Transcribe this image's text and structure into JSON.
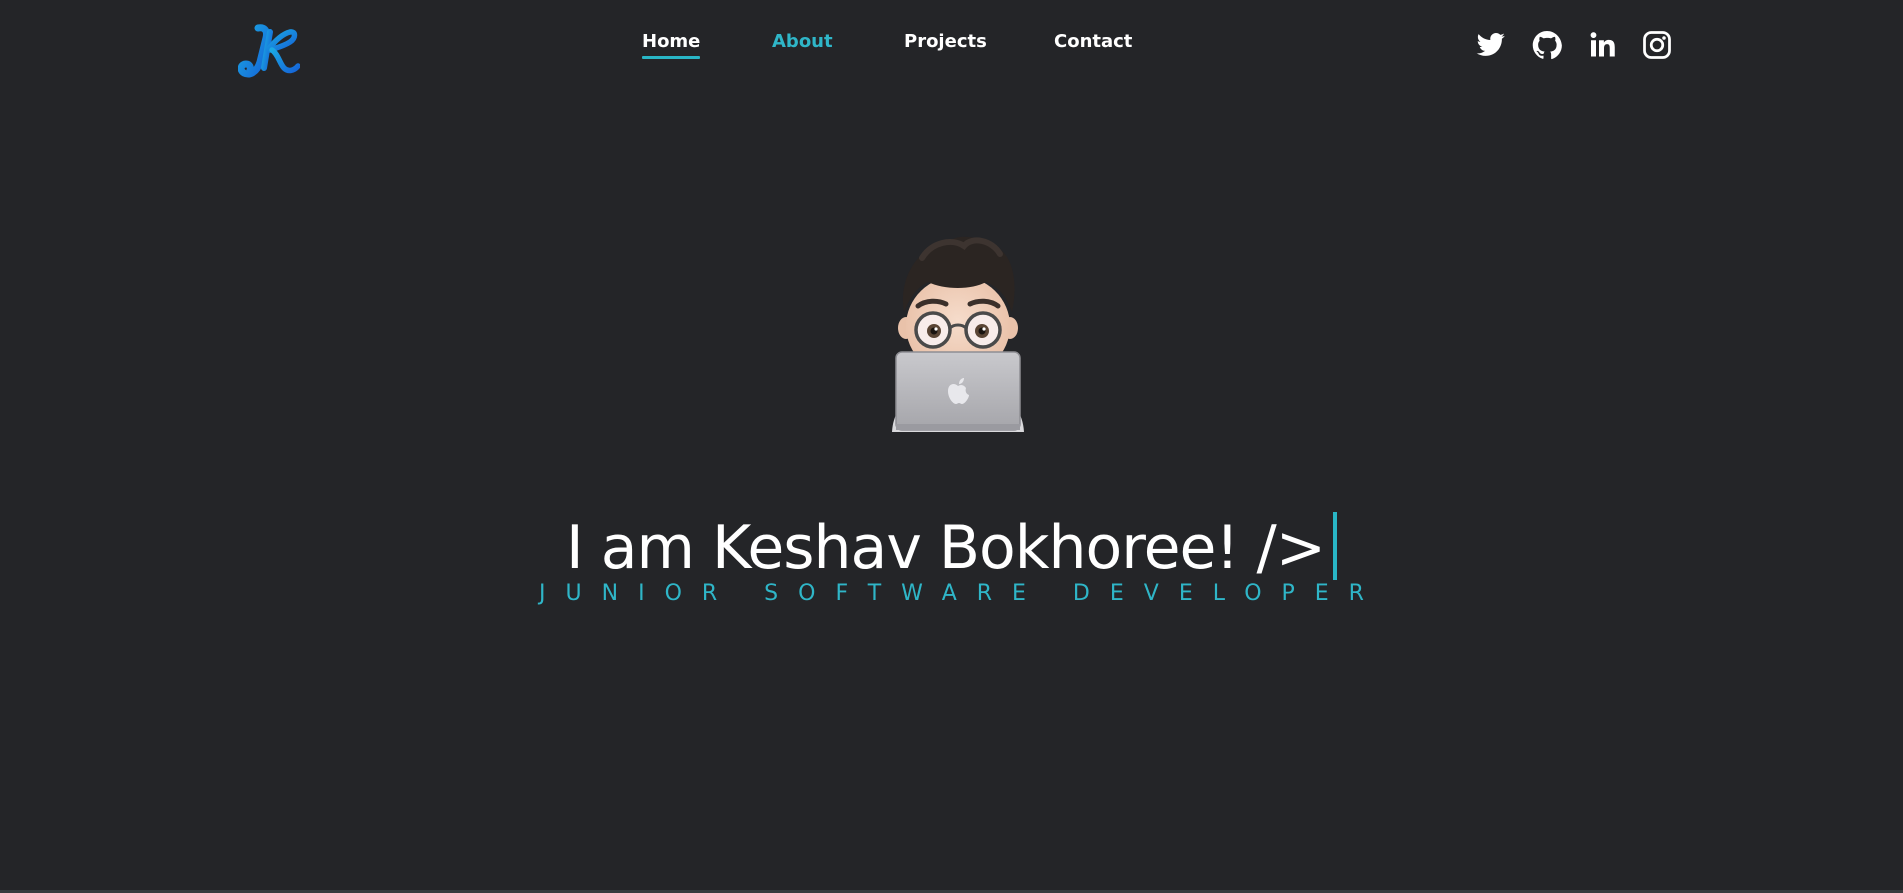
{
  "header": {
    "logo_icon": "kb-monogram-logo",
    "nav": [
      {
        "label": "Home",
        "state": "active"
      },
      {
        "label": "About",
        "state": "hover"
      },
      {
        "label": "Projects",
        "state": "default"
      },
      {
        "label": "Contact",
        "state": "default"
      }
    ],
    "social_icons": [
      "twitter-icon",
      "github-icon",
      "linkedin-icon",
      "instagram-icon"
    ]
  },
  "hero": {
    "avatar_icon": "memoji-avatar-with-laptop",
    "title": "I am Keshav Bokhoree! />",
    "subtitle": "JUNIOR SOFTWARE DEVELOPER"
  },
  "colors": {
    "background": "#242528",
    "accent": "#2fb6c8",
    "text": "#ffffff",
    "logo_gradient_start": "#1fa3e0",
    "logo_gradient_end": "#1565d8"
  }
}
